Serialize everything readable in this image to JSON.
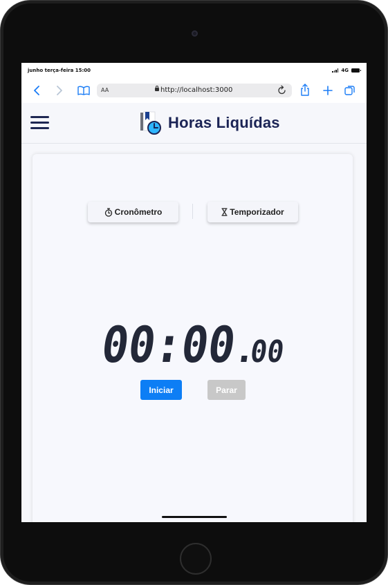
{
  "status_bar": {
    "time": "junho terça-feira 15:00",
    "network": "4G"
  },
  "browser": {
    "text_size_label": "AA",
    "url": "http://localhost:3000"
  },
  "app": {
    "title": "Horas Liquídas"
  },
  "modes": {
    "stopwatch_label": "Cronômetro",
    "timer_label": "Temporizador"
  },
  "display": {
    "main": "00:00",
    "separator": ".",
    "centis": "00"
  },
  "actions": {
    "start_label": "Iniciar",
    "stop_label": "Parar"
  },
  "colors": {
    "primary": "#0d7ef5",
    "disabled": "#c8c8c8",
    "navy": "#1b2455",
    "digits": "#232838",
    "ios_blue": "#1a7cf5"
  },
  "icons": [
    "back-chevron-icon",
    "forward-chevron-icon",
    "bookmarks-book-icon",
    "lock-icon",
    "reload-icon",
    "share-icon",
    "add-tab-icon",
    "tabs-icon",
    "hamburger-menu-icon",
    "logo-clock-icon",
    "stopwatch-icon",
    "hourglass-icon"
  ]
}
